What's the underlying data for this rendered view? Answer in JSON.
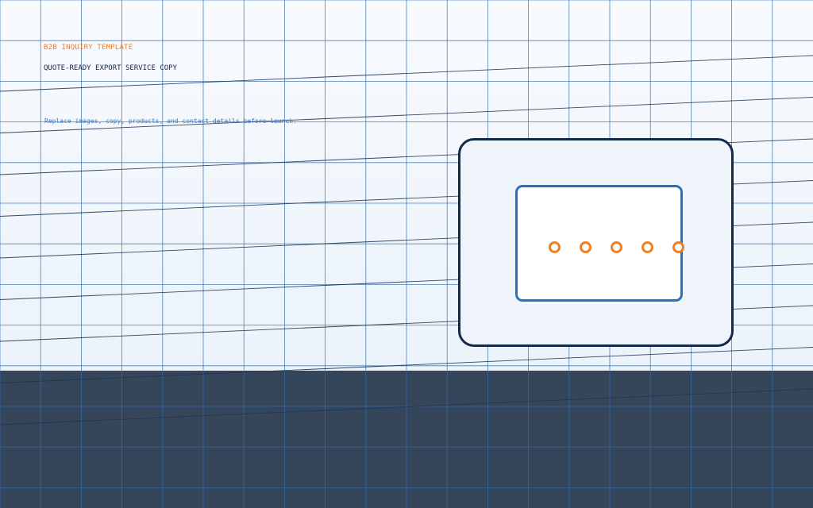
{
  "hero": {
    "eyebrow": "B2B INQUIRY TEMPLATE",
    "title": "QUOTE-READY EXPORT SERVICE COPY",
    "note": "Replace images, copy, products, and contact details before launch."
  },
  "colors": {
    "accent": "#f07e22",
    "title": "#13294b",
    "note": "#3f79c2",
    "grid": "#2f6cb0",
    "footer": "#36465a",
    "device_border": "#13294b",
    "screen_border": "#2673bb"
  },
  "illustration": {
    "frame_icon": "device-frame-icon",
    "screen_icon": "device-screen-icon",
    "indicator_icon": "indicator-ring-icon",
    "indicator_count": 5
  }
}
